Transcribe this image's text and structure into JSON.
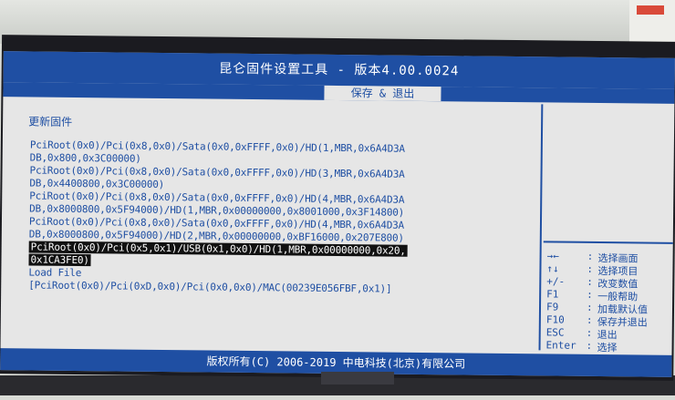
{
  "title": "昆仑固件设置工具 - 版本4.00.0024",
  "active_tab": "保存 & 退出",
  "section_title": "更新固件",
  "lines": [
    "PciRoot(0x0)/Pci(0x8,0x0)/Sata(0x0,0xFFFF,0x0)/HD(1,MBR,0x6A4D3A",
    "DB,0x800,0x3C00000)",
    "PciRoot(0x0)/Pci(0x8,0x0)/Sata(0x0,0xFFFF,0x0)/HD(3,MBR,0x6A4D3A",
    "DB,0x4400800,0x3C00000)",
    "PciRoot(0x0)/Pci(0x8,0x0)/Sata(0x0,0xFFFF,0x0)/HD(4,MBR,0x6A4D3A",
    "DB,0x8000800,0x5F94000)/HD(1,MBR,0x00000000,0x8001000,0x3F14800)",
    "PciRoot(0x0)/Pci(0x8,0x0)/Sata(0x0,0xFFFF,0x0)/HD(4,MBR,0x6A4D3A",
    "DB,0x8000800,0x5F94000)/HD(2,MBR,0x00000000,0xBF16000,0x207E800)",
    "PciRoot(0x0)/Pci(0x5,0x1)/USB(0x1,0x0)/HD(1,MBR,0x00000000,0x20,",
    "0x1CA3FE0)",
    "Load File",
    "[PciRoot(0x0)/Pci(0xD,0x0)/Pci(0x0,0x0)/MAC(00239E056FBF,0x1)]"
  ],
  "help": [
    {
      "key": "→←",
      "desc": "选择画面",
      "icon": "left-right-arrows-icon"
    },
    {
      "key": "↑↓",
      "desc": "选择项目",
      "icon": "up-down-arrows-icon"
    },
    {
      "key": "+/-",
      "desc": "改变数值"
    },
    {
      "key": "F1",
      "desc": "一般帮助"
    },
    {
      "key": "F9",
      "desc": "加载默认值"
    },
    {
      "key": "F10",
      "desc": "保存并退出"
    },
    {
      "key": "ESC",
      "desc": "退出"
    },
    {
      "key": "Enter",
      "desc": "选择"
    }
  ],
  "footer": "版权所有(C) 2006-2019 中电科技(北京)有限公司",
  "colors": {
    "accent": "#1f4fa3",
    "background": "#e6e6e6",
    "selection": "#111111"
  }
}
